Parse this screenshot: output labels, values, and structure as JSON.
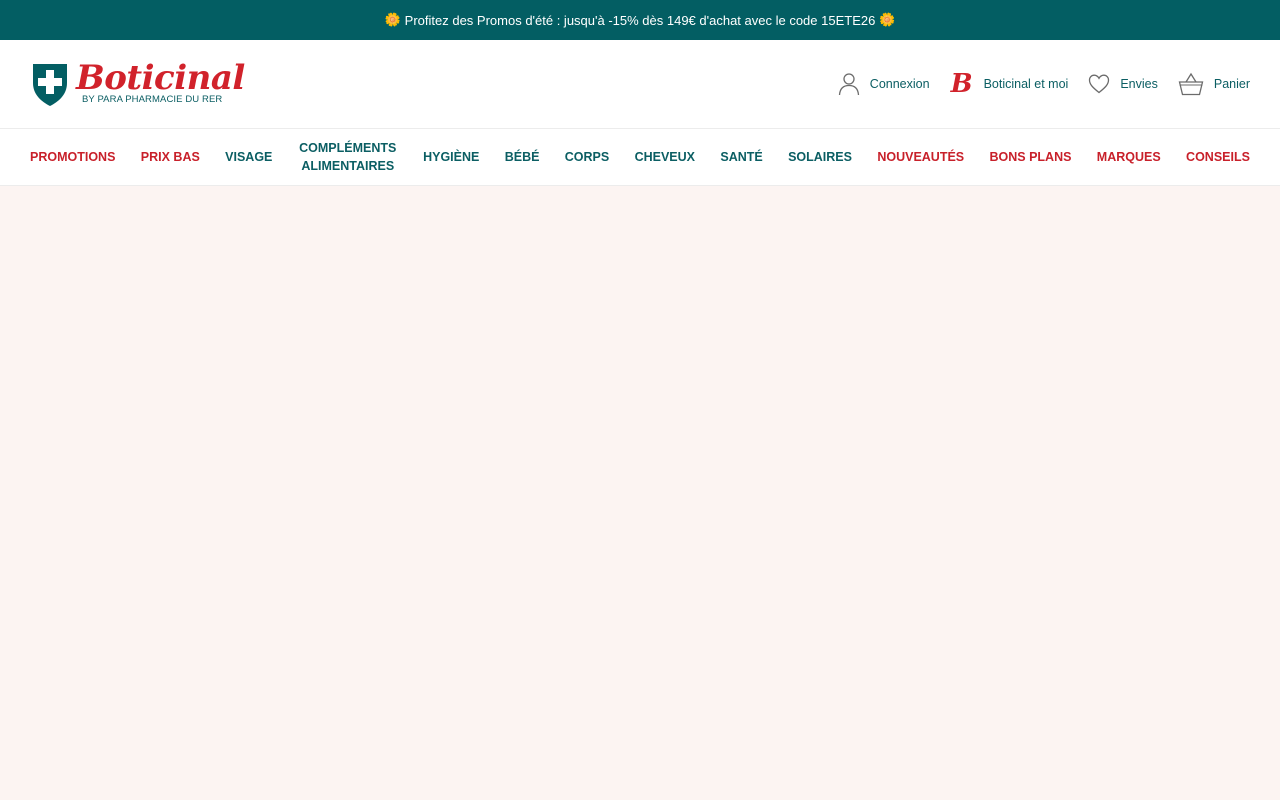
{
  "promo": {
    "text": "Profitez des Promos d'été : jusqu'à -15% dès 149€ d'achat avec le code 15ETE26",
    "icon": "sun-icon"
  },
  "brand": {
    "name": "Boticinal",
    "tagline": "BY PARA PHARMACIE DU RER",
    "primary_color": "#035e63",
    "accent_color": "#d1222b"
  },
  "header": {
    "actions": [
      {
        "label": "Connexion",
        "icon": "user-icon"
      },
      {
        "label": "Boticinal et moi",
        "icon": "boticinal-b-icon"
      },
      {
        "label": "Envies",
        "icon": "heart-icon"
      },
      {
        "label": "Panier",
        "icon": "basket-icon"
      }
    ]
  },
  "nav": {
    "items": [
      {
        "label": "PROMOTIONS",
        "color": "red"
      },
      {
        "label": "PRIX BAS",
        "color": "red"
      },
      {
        "label": "VISAGE",
        "color": "teal"
      },
      {
        "label": "COMPLÉMENTS ALIMENTAIRES",
        "color": "teal"
      },
      {
        "label": "HYGIÈNE",
        "color": "teal"
      },
      {
        "label": "BÉBÉ",
        "color": "teal"
      },
      {
        "label": "CORPS",
        "color": "teal"
      },
      {
        "label": "CHEVEUX",
        "color": "teal"
      },
      {
        "label": "SANTÉ",
        "color": "teal"
      },
      {
        "label": "SOLAIRES",
        "color": "teal"
      },
      {
        "label": "NOUVEAUTÉS",
        "color": "red"
      },
      {
        "label": "BONS PLANS",
        "color": "red"
      },
      {
        "label": "MARQUES",
        "color": "red"
      },
      {
        "label": "CONSEILS",
        "color": "red"
      }
    ]
  }
}
